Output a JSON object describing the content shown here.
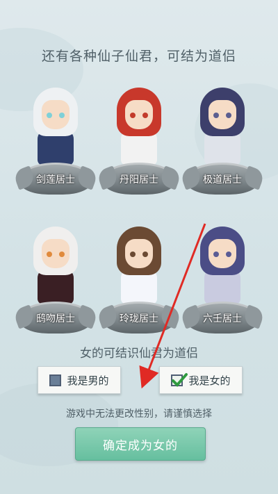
{
  "header": {
    "title": "还有各种仙子仙君，可结为道侣"
  },
  "characters": [
    {
      "name": "剑莲居士",
      "hair": "#eef1f3",
      "robe": "#2f3f6c",
      "eye": "#7fd0d8"
    },
    {
      "name": "丹阳居士",
      "hair": "#c8382b",
      "robe": "#f2f2f2",
      "eye": "#c33b2b"
    },
    {
      "name": "极道居士",
      "hair": "#3d3f6b",
      "robe": "#dfe3ea",
      "eye": "#5b5e90"
    },
    {
      "name": "鸱吻居士",
      "hair": "#f0efee",
      "robe": "#3a1f24",
      "eye": "#e08a3c"
    },
    {
      "name": "玲珑居士",
      "hair": "#6b4a33",
      "robe": "#f4f6fb",
      "eye": "#6b4a33"
    },
    {
      "name": "六壬居士",
      "hair": "#4b4d86",
      "robe": "#c9cbe0",
      "eye": "#5a5c95"
    }
  ],
  "gender": {
    "prompt": "女的可结识仙君为道侣",
    "male_label": "我是男的",
    "female_label": "我是女的",
    "selected": "female"
  },
  "warning": "游戏中无法更改性别，请谨慎选择",
  "confirm_label": "确定成为女的",
  "colors": {
    "accent": "#66bf9f",
    "arrow": "#e02a24",
    "check": "#2f9a3f"
  }
}
